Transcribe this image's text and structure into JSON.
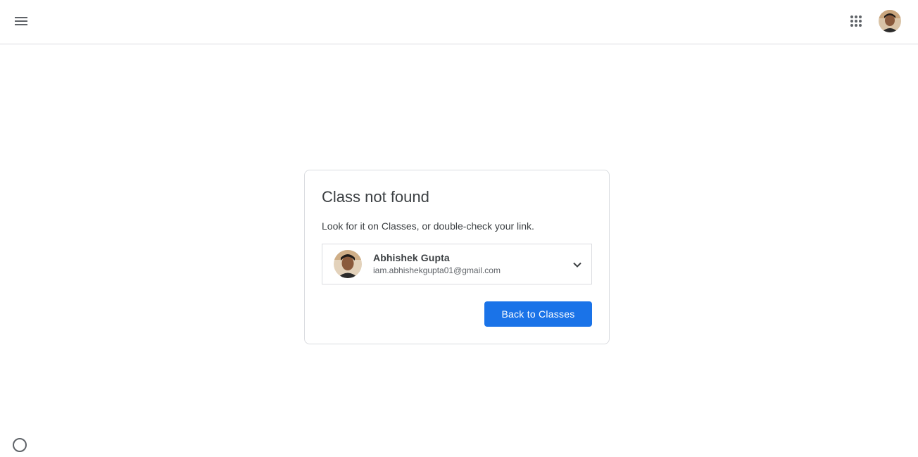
{
  "header": {
    "menu_icon": "hamburger-menu-icon",
    "apps_icon": "google-apps-grid-icon",
    "avatar_icon": "user-avatar"
  },
  "card": {
    "title": "Class not found",
    "description": "Look for it on Classes, or double-check your link.",
    "account": {
      "name": "Abhishek Gupta",
      "email": "iam.abhishekgupta01@gmail.com",
      "dropdown_icon": "chevron-down-icon"
    },
    "back_button_label": "Back to Classes"
  },
  "footer": {
    "help_icon": "help-icon"
  },
  "colors": {
    "accent": "#1a73e8",
    "border": "#dadce0",
    "text": "#3c4043",
    "secondary_text": "#5f6368"
  }
}
